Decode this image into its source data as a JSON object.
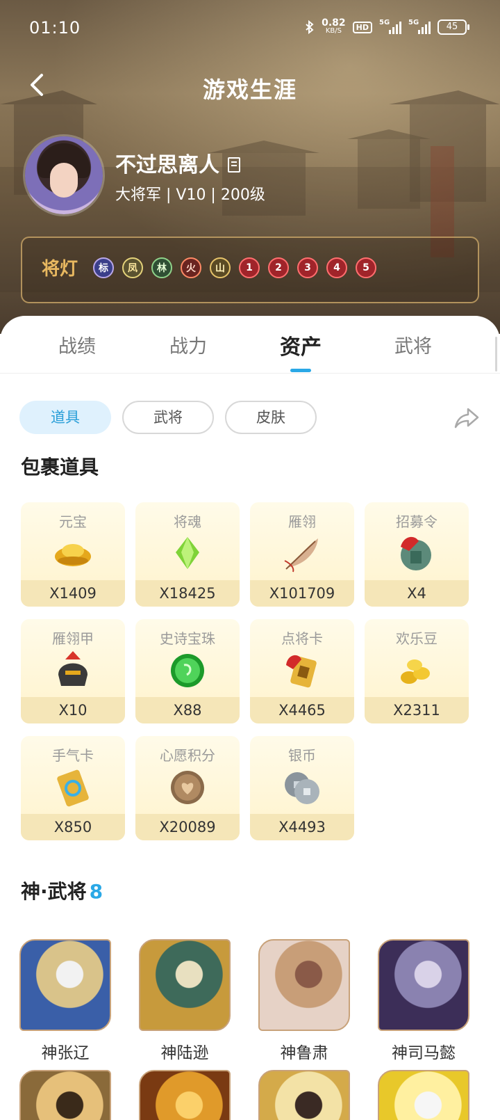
{
  "status_bar": {
    "time": "01:10",
    "net_speed_value": "0.82",
    "net_speed_unit": "KB/S",
    "hd_label": "HD",
    "sim1_label": "5G",
    "sim2_label": "5G",
    "battery": "45"
  },
  "header": {
    "title": "游戏生涯"
  },
  "profile": {
    "name": "不过思离人",
    "meta": "大将军 | V10 | 200级"
  },
  "lamps": {
    "label": "将灯",
    "items": [
      {
        "text": "标",
        "color": "#3b3f8a",
        "ring": "#b9a7e8",
        "fg": "#ffffff"
      },
      {
        "text": "凤",
        "color": "#5a5230",
        "ring": "#e4d27a",
        "fg": "#ffe9a0"
      },
      {
        "text": "林",
        "color": "#2f4f34",
        "ring": "#8fd28a",
        "fg": "#e7ffd6"
      },
      {
        "text": "火",
        "color": "#6a2420",
        "ring": "#ff8a66",
        "fg": "#ffd9c8"
      },
      {
        "text": "山",
        "color": "#5a4a24",
        "ring": "#e6c36a",
        "fg": "#fff1b8"
      },
      {
        "text": "1",
        "color": "#a0242a",
        "ring": "#ff6f6f",
        "fg": "#ffffff"
      },
      {
        "text": "2",
        "color": "#a0242a",
        "ring": "#ff6f6f",
        "fg": "#ffffff"
      },
      {
        "text": "3",
        "color": "#a0242a",
        "ring": "#ff6f6f",
        "fg": "#ffffff"
      },
      {
        "text": "4",
        "color": "#a0242a",
        "ring": "#ff6f6f",
        "fg": "#ffffff"
      },
      {
        "text": "5",
        "color": "#a0242a",
        "ring": "#ff6f6f",
        "fg": "#ffffff"
      }
    ]
  },
  "tabs": [
    {
      "label": "战绩",
      "active": false
    },
    {
      "label": "战力",
      "active": false
    },
    {
      "label": "资产",
      "active": true
    },
    {
      "label": "武将",
      "active": false
    }
  ],
  "filters": [
    {
      "label": "道具",
      "active": true
    },
    {
      "label": "武将",
      "active": false
    },
    {
      "label": "皮肤",
      "active": false
    }
  ],
  "items_section": {
    "title": "包裹道具",
    "items": [
      {
        "name": "元宝",
        "count": "X1409",
        "icon": "gold-ingot-icon"
      },
      {
        "name": "将魂",
        "count": "X18425",
        "icon": "green-soul-icon"
      },
      {
        "name": "雁翎",
        "count": "X101709",
        "icon": "feather-icon"
      },
      {
        "name": "招募令",
        "count": "X4",
        "icon": "recruit-token-icon"
      },
      {
        "name": "雁翎甲",
        "count": "X10",
        "icon": "armor-helmet-icon"
      },
      {
        "name": "史诗宝珠",
        "count": "X88",
        "icon": "epic-orb-icon"
      },
      {
        "name": "点将卡",
        "count": "X4465",
        "icon": "general-card-icon"
      },
      {
        "name": "欢乐豆",
        "count": "X2311",
        "icon": "beans-icon"
      },
      {
        "name": "手气卡",
        "count": "X850",
        "icon": "luck-card-icon"
      },
      {
        "name": "心愿积分",
        "count": "X20089",
        "icon": "heart-coin-icon"
      },
      {
        "name": "银币",
        "count": "X4493",
        "icon": "silver-coin-icon"
      }
    ]
  },
  "heroes_section": {
    "title": "神·武将",
    "count": "8",
    "heroes": [
      {
        "name": "神张辽",
        "colors": [
          "#3a5fa8",
          "#d9c38a",
          "#f2f2f2"
        ]
      },
      {
        "name": "神陆逊",
        "colors": [
          "#c79a3c",
          "#3e6a5a",
          "#e8e0c0"
        ]
      },
      {
        "name": "神鲁肃",
        "colors": [
          "#e6d2c6",
          "#c89e78",
          "#8a5a48"
        ]
      },
      {
        "name": "神司马懿",
        "colors": [
          "#3c2e58",
          "#8a82b0",
          "#d9d2e8"
        ]
      },
      {
        "name": "",
        "colors": [
          "#8a6a3a",
          "#e6c07a",
          "#3a2a1a"
        ]
      },
      {
        "name": "",
        "colors": [
          "#7a3a12",
          "#e09a2a",
          "#fbd06a"
        ]
      },
      {
        "name": "",
        "colors": [
          "#d4aa4a",
          "#f3e2a6",
          "#3a2a24"
        ]
      },
      {
        "name": "",
        "colors": [
          "#e8c82a",
          "#fff0a0",
          "#f6f6f6"
        ]
      }
    ]
  }
}
